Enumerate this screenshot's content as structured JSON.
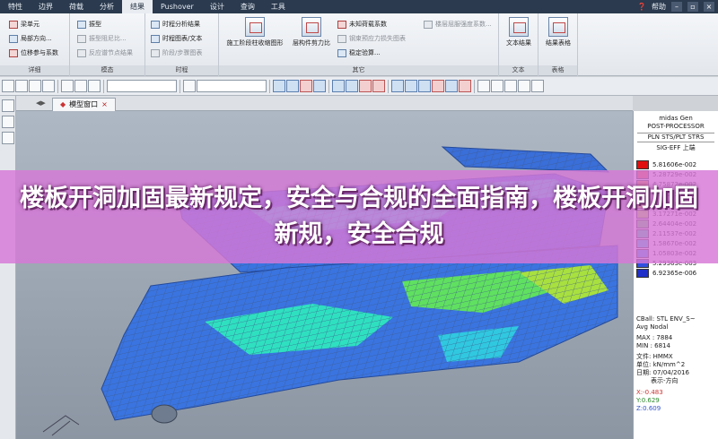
{
  "menubar": {
    "items": [
      "特性",
      "边界",
      "荷载",
      "分析",
      "结果",
      "Pushover",
      "设计",
      "查询",
      "工具"
    ],
    "active_index": 4,
    "help_label": "帮助"
  },
  "ribbon": {
    "groups": [
      {
        "title": "详细",
        "items": [
          "梁单元",
          "局部方向...",
          "位移参与系数"
        ]
      },
      {
        "title": "模态",
        "items": [
          "振型",
          "振型阻尼比...",
          "反应谱节点结果"
        ]
      },
      {
        "title": "时程",
        "items": [
          "时程分析结果",
          "时程图表/文本",
          "阶段/步骤图表"
        ]
      },
      {
        "title": "其它",
        "items": [
          "施工阶段柱收缩图形",
          "层构件剪力比",
          "未知荷载系数",
          "钢束预应力损失图表",
          "稳定验算...",
          "楼层屈服强度系数..."
        ]
      },
      {
        "title": "文本",
        "items": [
          "文本结果"
        ]
      },
      {
        "title": "表格",
        "items": [
          "结果表格"
        ]
      }
    ]
  },
  "tab": {
    "label": "模型窗口"
  },
  "legend": {
    "header": [
      "midas Gen",
      "POST-PROCESSOR",
      "PLN STS/PLT STRS",
      "SIG-EFF 上端"
    ],
    "values": [
      "5.81606e-002",
      "5.28729e-002",
      "4.75872e-002",
      "4.23005e-002",
      "3.70138e-002",
      "3.17271e-002",
      "2.64404e-002",
      "2.11537e-002",
      "1.58670e-002",
      "1.05803e-002",
      "5.29363e-003",
      "6.92365e-006"
    ],
    "colors": [
      "#e01010",
      "#e85030",
      "#e88a30",
      "#e8c030",
      "#d8e030",
      "#a8e040",
      "#60d860",
      "#30d8a0",
      "#30c8e0",
      "#3090e8",
      "#3050e0",
      "#2030c8"
    ],
    "info": [
      "CBall: STL ENV_S~",
      "Avg Nodal",
      "MAX : 7884",
      "MIN : 6814",
      "文件: HMMX",
      "单位: kN/mm^2",
      "日期: 07/04/2016",
      "表示-方向"
    ],
    "axes": {
      "x": "X:-0.483",
      "y": "Y:0.629",
      "z": "Z:0.609"
    }
  },
  "banner": {
    "title": "楼板开洞加固最新规定，安全与合规的全面指南，楼板开洞加固新规，安全合规"
  }
}
